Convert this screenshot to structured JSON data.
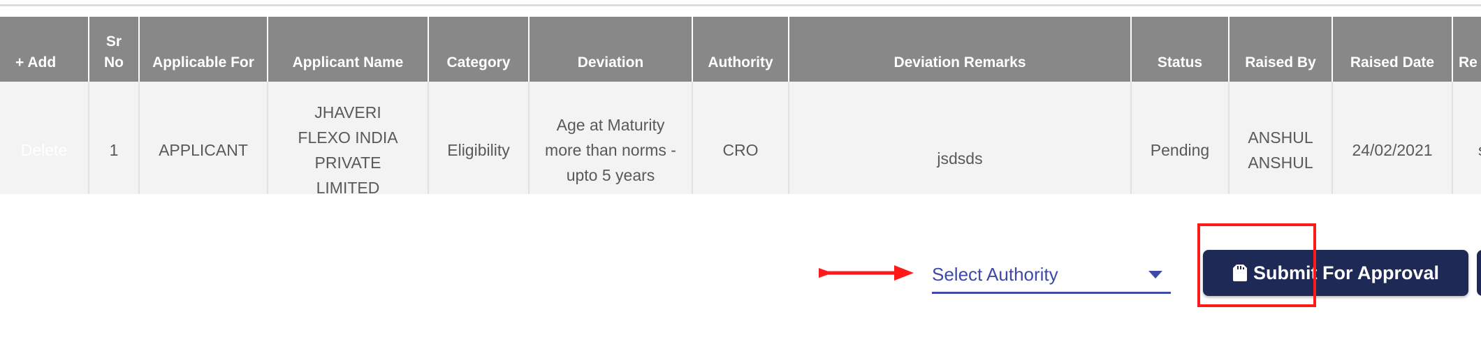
{
  "table": {
    "add_label": "Add",
    "headers": {
      "sr_no": "Sr No",
      "applicable_for": "Applicable For",
      "applicant_name": "Applicant Name",
      "category": "Category",
      "deviation": "Deviation",
      "authority": "Authority",
      "deviation_remarks": "Deviation Remarks",
      "status": "Status",
      "raised_by": "Raised By",
      "raised_date": "Raised Date",
      "partial_header": "Re"
    },
    "rows": [
      {
        "action": "Delete",
        "sr_no": "1",
        "applicable_for": "APPLICANT",
        "applicant_name": "JHAVERI FLEXO INDIA PRIVATE LIMITED",
        "category": "Eligibility",
        "deviation": "Age at Maturity more than norms - upto 5 years",
        "authority": "CRO",
        "deviation_remarks": "jsdsds",
        "status": "Pending",
        "raised_by": "ANSHUL ANSHUL",
        "raised_date": "24/02/2021",
        "partial_cell": "s"
      }
    ]
  },
  "authority_select": {
    "label": "Select Authority"
  },
  "submit_button": {
    "label": "Submit For Approval"
  },
  "colors": {
    "header_bg": "#888888",
    "row_bg": "#f3f3f4",
    "accent": "#3f4aa8",
    "button_bg": "#1e2a55",
    "annotation": "#ff1a1a"
  },
  "icons": [
    "plus-icon",
    "clipboard-icon",
    "chevron-down-icon",
    "annotation-arrow-icon"
  ]
}
